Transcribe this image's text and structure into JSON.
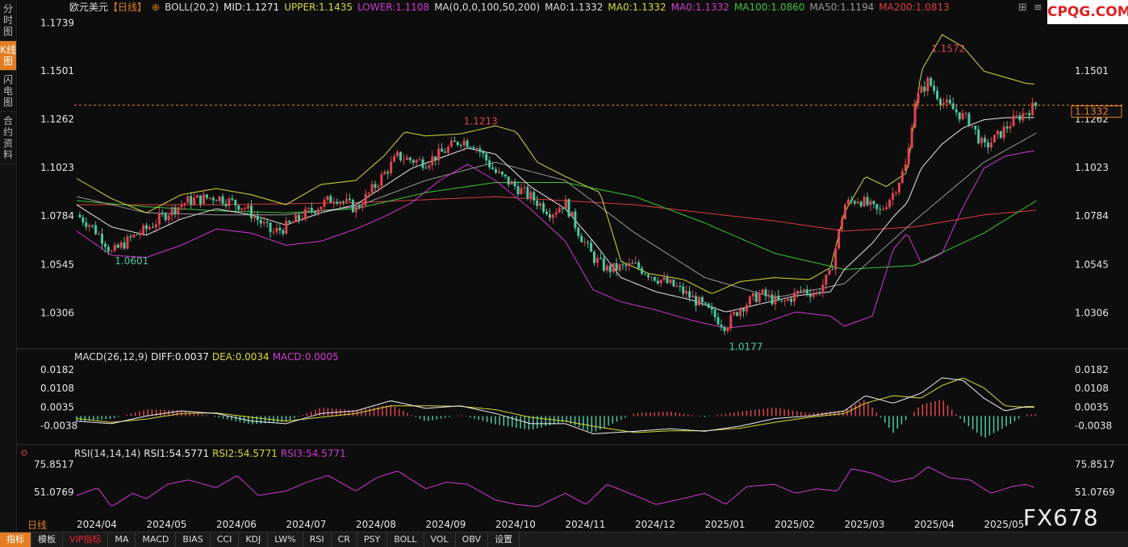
{
  "sidebar": {
    "tabs": [
      "分时图",
      "K线图",
      "闪电图",
      "合约资料"
    ],
    "active": 1
  },
  "header": {
    "symbol": "欧元美元",
    "period": "【日线】",
    "boll": "BOLL(20,2)",
    "mid": "MID:1.1271",
    "upper": "UPPER:1.1435",
    "lower": "LOWER:1.1108",
    "ma_def": "MA(0,0,0,100,50,200)",
    "ma0a": "MA0:1.1332",
    "ma0b": "MA0:1.1332",
    "ma0c": "MA0:1.1332",
    "ma100": "MA100:1.0860",
    "ma50": "MA50:1.1194",
    "ma200": "MA200:1.0813"
  },
  "macd_header": {
    "label": "MACD(26,12,9)",
    "diff": "DIFF:0.0037",
    "dea": "DEA:0.0034",
    "macd": "MACD:0.0005"
  },
  "rsi_header": {
    "label": "RSI(14,14,14)",
    "rsi1": "RSI1:54.5771",
    "rsi2": "RSI2:54.5771",
    "rsi3": "RSI3:54.5771"
  },
  "period_label": "日线",
  "watermark_top": "CPQG.COM",
  "watermark_big": "FX678",
  "bottom_tabs": [
    "指标",
    "模板",
    "VIP指标",
    "MA",
    "MACD",
    "BIAS",
    "CCI",
    "KDJ",
    "LW%",
    "RSI",
    "CR",
    "PSY",
    "BOLL",
    "VOL",
    "OBV",
    "设置"
  ],
  "colors": {
    "up": "#e0444f",
    "down": "#4bc8a0",
    "upper": "#d9d93a",
    "lower": "#d03ad0",
    "mid": "#e8e8e8",
    "ma50": "#999999",
    "ma100": "#3cc43c",
    "ma200": "#e03c3c",
    "accent": "#e27d22"
  },
  "chart_data": {
    "type": "candlestick",
    "x_ticks": [
      "2024/04",
      "2024/05",
      "2024/06",
      "2024/07",
      "2024/08",
      "2024/09",
      "2024/10",
      "2024/11",
      "2024/12",
      "2025/01",
      "2025/02",
      "2025/03",
      "2025/04",
      "2025/05"
    ],
    "price_ticks": [
      1.1739,
      1.1501,
      1.1262,
      1.1023,
      1.0784,
      1.0545,
      1.0306
    ],
    "right_ticks": [
      1.1501,
      1.1262,
      1.1023,
      1.0784,
      1.0545,
      1.0306
    ],
    "ylim": [
      1.014,
      1.178
    ],
    "current_price": 1.1332,
    "annotations": [
      {
        "label": "1.0601",
        "month": 0.5,
        "value": 1.0601,
        "color": "#4bc8a0"
      },
      {
        "label": "1.1213",
        "month": 5.5,
        "value": 1.1213,
        "color": "#e0444f"
      },
      {
        "label": "1.0177",
        "month": 9.3,
        "value": 1.0177,
        "color": "#4bc8a0"
      },
      {
        "label": "1.1572",
        "month": 12.2,
        "value": 1.1572,
        "color": "#e0444f"
      }
    ],
    "close_path": [
      [
        0.0,
        1.079
      ],
      [
        0.2,
        1.074
      ],
      [
        0.4,
        1.066
      ],
      [
        0.5,
        1.0601
      ],
      [
        0.8,
        1.068
      ],
      [
        1.0,
        1.072
      ],
      [
        1.3,
        1.08
      ],
      [
        1.6,
        1.086
      ],
      [
        2.0,
        1.088
      ],
      [
        2.4,
        1.083
      ],
      [
        2.8,
        1.07
      ],
      [
        3.0,
        1.073
      ],
      [
        3.3,
        1.08
      ],
      [
        3.7,
        1.088
      ],
      [
        4.0,
        1.082
      ],
      [
        4.2,
        1.09
      ],
      [
        4.4,
        1.099
      ],
      [
        4.6,
        1.108
      ],
      [
        4.8,
        1.106
      ],
      [
        5.0,
        1.105
      ],
      [
        5.2,
        1.109
      ],
      [
        5.5,
        1.116
      ],
      [
        5.7,
        1.114
      ],
      [
        6.0,
        1.1
      ],
      [
        6.2,
        1.095
      ],
      [
        6.5,
        1.088
      ],
      [
        6.8,
        1.08
      ],
      [
        7.0,
        1.085
      ],
      [
        7.2,
        1.07
      ],
      [
        7.4,
        1.058
      ],
      [
        7.6,
        1.052
      ],
      [
        8.0,
        1.054
      ],
      [
        8.3,
        1.048
      ],
      [
        8.6,
        1.043
      ],
      [
        8.9,
        1.036
      ],
      [
        9.1,
        1.03
      ],
      [
        9.3,
        1.024
      ],
      [
        9.5,
        1.033
      ],
      [
        9.8,
        1.04
      ],
      [
        10.1,
        1.035
      ],
      [
        10.4,
        1.042
      ],
      [
        10.6,
        1.04
      ],
      [
        10.8,
        1.05
      ],
      [
        11.0,
        1.084
      ],
      [
        11.2,
        1.087
      ],
      [
        11.5,
        1.08
      ],
      [
        11.7,
        1.09
      ],
      [
        11.9,
        1.105
      ],
      [
        12.0,
        1.135
      ],
      [
        12.2,
        1.145
      ],
      [
        12.4,
        1.135
      ],
      [
        12.6,
        1.13
      ],
      [
        12.8,
        1.125
      ],
      [
        13.0,
        1.112
      ],
      [
        13.2,
        1.118
      ],
      [
        13.4,
        1.125
      ],
      [
        13.6,
        1.13
      ],
      [
        13.75,
        1.1332
      ]
    ],
    "upper_path": [
      [
        0.0,
        1.097
      ],
      [
        0.5,
        1.087
      ],
      [
        1.0,
        1.08
      ],
      [
        1.5,
        1.089
      ],
      [
        2.0,
        1.092
      ],
      [
        2.5,
        1.089
      ],
      [
        3.0,
        1.084
      ],
      [
        3.5,
        1.094
      ],
      [
        4.0,
        1.096
      ],
      [
        4.4,
        1.108
      ],
      [
        4.7,
        1.12
      ],
      [
        5.0,
        1.118
      ],
      [
        5.5,
        1.119
      ],
      [
        6.0,
        1.123
      ],
      [
        6.3,
        1.12
      ],
      [
        6.6,
        1.105
      ],
      [
        7.0,
        1.098
      ],
      [
        7.5,
        1.09
      ],
      [
        7.8,
        1.056
      ],
      [
        8.2,
        1.05
      ],
      [
        8.7,
        1.047
      ],
      [
        9.1,
        1.04
      ],
      [
        9.5,
        1.046
      ],
      [
        10.0,
        1.048
      ],
      [
        10.5,
        1.047
      ],
      [
        10.8,
        1.053
      ],
      [
        11.0,
        1.08
      ],
      [
        11.3,
        1.098
      ],
      [
        11.6,
        1.093
      ],
      [
        11.9,
        1.1
      ],
      [
        12.1,
        1.15
      ],
      [
        12.4,
        1.168
      ],
      [
        12.7,
        1.162
      ],
      [
        13.0,
        1.15
      ],
      [
        13.3,
        1.147
      ],
      [
        13.6,
        1.144
      ],
      [
        13.75,
        1.1435
      ]
    ],
    "lower_path": [
      [
        0.0,
        1.071
      ],
      [
        0.5,
        1.059
      ],
      [
        1.0,
        1.058
      ],
      [
        1.5,
        1.064
      ],
      [
        2.0,
        1.072
      ],
      [
        2.5,
        1.07
      ],
      [
        3.0,
        1.064
      ],
      [
        3.5,
        1.066
      ],
      [
        4.0,
        1.072
      ],
      [
        4.4,
        1.078
      ],
      [
        4.8,
        1.085
      ],
      [
        5.2,
        1.096
      ],
      [
        5.6,
        1.104
      ],
      [
        6.0,
        1.096
      ],
      [
        6.5,
        1.082
      ],
      [
        7.0,
        1.066
      ],
      [
        7.4,
        1.042
      ],
      [
        7.8,
        1.036
      ],
      [
        8.3,
        1.032
      ],
      [
        8.8,
        1.027
      ],
      [
        9.3,
        1.023
      ],
      [
        9.8,
        1.025
      ],
      [
        10.3,
        1.031
      ],
      [
        10.8,
        1.029
      ],
      [
        11.0,
        1.024
      ],
      [
        11.4,
        1.029
      ],
      [
        11.7,
        1.062
      ],
      [
        11.9,
        1.07
      ],
      [
        12.1,
        1.055
      ],
      [
        12.4,
        1.06
      ],
      [
        12.7,
        1.083
      ],
      [
        13.0,
        1.102
      ],
      [
        13.3,
        1.108
      ],
      [
        13.6,
        1.11
      ],
      [
        13.75,
        1.1108
      ]
    ],
    "mid_path": [
      [
        0.0,
        1.084
      ],
      [
        0.5,
        1.073
      ],
      [
        1.0,
        1.069
      ],
      [
        1.5,
        1.077
      ],
      [
        2.0,
        1.082
      ],
      [
        2.5,
        1.079
      ],
      [
        3.0,
        1.074
      ],
      [
        3.5,
        1.08
      ],
      [
        4.0,
        1.084
      ],
      [
        4.4,
        1.093
      ],
      [
        4.8,
        1.102
      ],
      [
        5.2,
        1.107
      ],
      [
        5.6,
        1.112
      ],
      [
        6.0,
        1.109
      ],
      [
        6.5,
        1.093
      ],
      [
        7.0,
        1.082
      ],
      [
        7.4,
        1.066
      ],
      [
        7.8,
        1.048
      ],
      [
        8.3,
        1.041
      ],
      [
        8.8,
        1.037
      ],
      [
        9.3,
        1.031
      ],
      [
        9.8,
        1.035
      ],
      [
        10.3,
        1.039
      ],
      [
        10.8,
        1.041
      ],
      [
        11.0,
        1.052
      ],
      [
        11.4,
        1.065
      ],
      [
        11.7,
        1.078
      ],
      [
        11.9,
        1.085
      ],
      [
        12.1,
        1.102
      ],
      [
        12.4,
        1.114
      ],
      [
        12.7,
        1.122
      ],
      [
        13.0,
        1.126
      ],
      [
        13.3,
        1.127
      ],
      [
        13.6,
        1.1271
      ],
      [
        13.75,
        1.1271
      ]
    ],
    "ma50_path": [
      [
        0.0,
        1.088
      ],
      [
        1.0,
        1.08
      ],
      [
        2.0,
        1.079
      ],
      [
        3.0,
        1.079
      ],
      [
        4.0,
        1.083
      ],
      [
        5.0,
        1.096
      ],
      [
        6.0,
        1.105
      ],
      [
        7.0,
        1.096
      ],
      [
        8.0,
        1.07
      ],
      [
        9.0,
        1.048
      ],
      [
        10.0,
        1.038
      ],
      [
        11.0,
        1.045
      ],
      [
        12.0,
        1.076
      ],
      [
        13.0,
        1.105
      ],
      [
        13.75,
        1.1194
      ]
    ],
    "ma100_path": [
      [
        0.0,
        1.086
      ],
      [
        1.0,
        1.083
      ],
      [
        2.0,
        1.081
      ],
      [
        3.0,
        1.08
      ],
      [
        4.0,
        1.082
      ],
      [
        5.0,
        1.09
      ],
      [
        6.0,
        1.095
      ],
      [
        7.0,
        1.095
      ],
      [
        8.0,
        1.088
      ],
      [
        9.0,
        1.075
      ],
      [
        10.0,
        1.06
      ],
      [
        11.0,
        1.052
      ],
      [
        12.0,
        1.054
      ],
      [
        13.0,
        1.07
      ],
      [
        13.75,
        1.086
      ]
    ],
    "ma200_path": [
      [
        0.0,
        1.084
      ],
      [
        2.0,
        1.084
      ],
      [
        4.0,
        1.085
      ],
      [
        6.0,
        1.088
      ],
      [
        8.0,
        1.084
      ],
      [
        10.0,
        1.076
      ],
      [
        11.0,
        1.071
      ],
      [
        12.0,
        1.073
      ],
      [
        13.0,
        1.079
      ],
      [
        13.75,
        1.0813
      ]
    ],
    "macd": {
      "ticks": [
        0.0182,
        0.0108,
        0.0035,
        -0.0038
      ],
      "ylim": [
        -0.01,
        0.021
      ],
      "diff_path": [
        [
          0.0,
          -0.002
        ],
        [
          0.5,
          -0.003
        ],
        [
          1.0,
          0.0
        ],
        [
          1.5,
          0.002
        ],
        [
          2.0,
          0.001
        ],
        [
          2.5,
          -0.002
        ],
        [
          3.0,
          -0.003
        ],
        [
          3.5,
          0.001
        ],
        [
          4.0,
          0.002
        ],
        [
          4.5,
          0.006
        ],
        [
          5.0,
          0.003
        ],
        [
          5.5,
          0.004
        ],
        [
          6.0,
          0.001
        ],
        [
          6.5,
          -0.003
        ],
        [
          7.0,
          -0.003
        ],
        [
          7.4,
          -0.007
        ],
        [
          8.0,
          -0.006
        ],
        [
          8.5,
          -0.005
        ],
        [
          9.0,
          -0.006
        ],
        [
          9.5,
          -0.004
        ],
        [
          10.0,
          -0.001
        ],
        [
          10.5,
          0.0
        ],
        [
          11.0,
          0.002
        ],
        [
          11.3,
          0.008
        ],
        [
          11.7,
          0.005
        ],
        [
          12.1,
          0.009
        ],
        [
          12.4,
          0.015
        ],
        [
          12.7,
          0.014
        ],
        [
          13.0,
          0.007
        ],
        [
          13.3,
          0.002
        ],
        [
          13.6,
          0.0037
        ],
        [
          13.75,
          0.0037
        ]
      ],
      "dea_path": [
        [
          0.0,
          -0.001
        ],
        [
          0.5,
          -0.0025
        ],
        [
          1.0,
          -0.0012
        ],
        [
          1.5,
          0.001
        ],
        [
          2.0,
          0.0012
        ],
        [
          2.5,
          -0.0005
        ],
        [
          3.0,
          -0.002
        ],
        [
          3.5,
          -0.0005
        ],
        [
          4.0,
          0.001
        ],
        [
          4.5,
          0.004
        ],
        [
          5.0,
          0.004
        ],
        [
          5.5,
          0.0038
        ],
        [
          6.0,
          0.0025
        ],
        [
          6.5,
          -0.0005
        ],
        [
          7.0,
          -0.002
        ],
        [
          7.4,
          -0.004
        ],
        [
          8.0,
          -0.0065
        ],
        [
          8.5,
          -0.0058
        ],
        [
          9.0,
          -0.0058
        ],
        [
          9.5,
          -0.0048
        ],
        [
          10.0,
          -0.0025
        ],
        [
          10.5,
          -0.0005
        ],
        [
          11.0,
          0.001
        ],
        [
          11.3,
          0.005
        ],
        [
          11.7,
          0.008
        ],
        [
          12.1,
          0.007
        ],
        [
          12.4,
          0.012
        ],
        [
          12.7,
          0.015
        ],
        [
          13.0,
          0.011
        ],
        [
          13.3,
          0.004
        ],
        [
          13.6,
          0.0034
        ],
        [
          13.75,
          0.0034
        ]
      ]
    },
    "rsi": {
      "ticks": [
        75.8517,
        51.0769
      ],
      "ylim": [
        30,
        82
      ],
      "path": [
        [
          0.0,
          48
        ],
        [
          0.3,
          55
        ],
        [
          0.5,
          38
        ],
        [
          0.8,
          50
        ],
        [
          1.0,
          45
        ],
        [
          1.3,
          58
        ],
        [
          1.6,
          62
        ],
        [
          2.0,
          55
        ],
        [
          2.3,
          66
        ],
        [
          2.6,
          48
        ],
        [
          3.0,
          52
        ],
        [
          3.3,
          60
        ],
        [
          3.6,
          66
        ],
        [
          4.0,
          52
        ],
        [
          4.3,
          64
        ],
        [
          4.6,
          70
        ],
        [
          5.0,
          54
        ],
        [
          5.3,
          60
        ],
        [
          5.6,
          58
        ],
        [
          6.0,
          44
        ],
        [
          6.3,
          40
        ],
        [
          6.6,
          38
        ],
        [
          7.0,
          50
        ],
        [
          7.3,
          40
        ],
        [
          7.6,
          58
        ],
        [
          8.0,
          48
        ],
        [
          8.3,
          40
        ],
        [
          8.6,
          44
        ],
        [
          9.0,
          50
        ],
        [
          9.3,
          40
        ],
        [
          9.6,
          56
        ],
        [
          10.0,
          58
        ],
        [
          10.3,
          50
        ],
        [
          10.6,
          54
        ],
        [
          10.9,
          52
        ],
        [
          11.1,
          72
        ],
        [
          11.4,
          68
        ],
        [
          11.7,
          60
        ],
        [
          12.0,
          64
        ],
        [
          12.2,
          74
        ],
        [
          12.5,
          64
        ],
        [
          12.8,
          62
        ],
        [
          13.1,
          50
        ],
        [
          13.4,
          56
        ],
        [
          13.6,
          58
        ],
        [
          13.75,
          54.5771
        ]
      ]
    }
  }
}
